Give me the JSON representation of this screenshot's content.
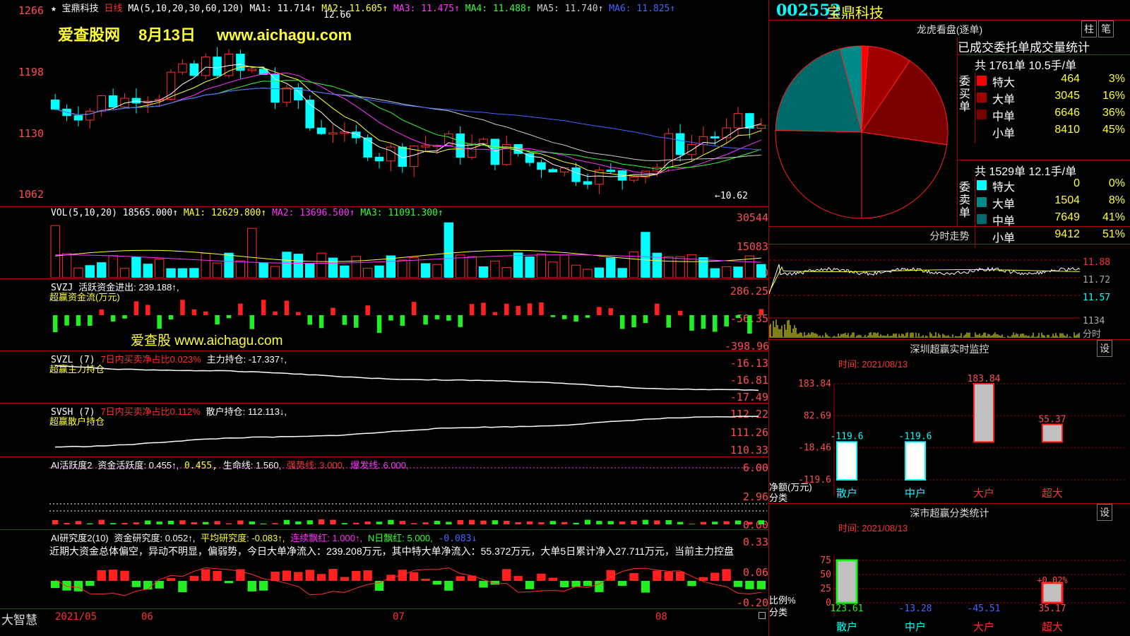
{
  "stock": {
    "code": "002552",
    "name": "宝鼎科技",
    "period": "日线",
    "star": "★"
  },
  "watermark": {
    "line1": "爱查股网",
    "date": "8月13日",
    "url": "www.aichagu.com",
    "line2": "爱查股 www.aichagu.com"
  },
  "main_panel": {
    "ma_label": "MA(5,10,20,30,60,120)",
    "ma_values": [
      {
        "name": "MA1:",
        "value": "11.714↑",
        "color": "#ffffff"
      },
      {
        "name": "MA2:",
        "value": "11.605↑",
        "color": "#ffff33"
      },
      {
        "name": "MA3:",
        "value": "11.475↑",
        "color": "#ff33ff"
      },
      {
        "name": "MA4:",
        "value": "11.488↑",
        "color": "#33ff33"
      },
      {
        "name": "MA5:",
        "value": "11.740↑",
        "color": "#cccccc"
      },
      {
        "name": "MA6:",
        "value": "11.825↑",
        "color": "#4466ff"
      }
    ],
    "y_ticks": [
      "1266",
      "1198",
      "1130",
      "1062"
    ],
    "high_label": "12.66",
    "low_label": "←10.62"
  },
  "vol_panel": {
    "label": "VOL(5,10,20)",
    "value": "18565.000↑",
    "ma1": "MA1: 12629.800↑",
    "ma2": "MA2: 13696.500↑",
    "ma3": "MA3: 11091.300↑",
    "y_ticks": [
      "30544",
      "15083",
      "0"
    ]
  },
  "svzj_panel": {
    "label": "SVZJ",
    "desc": "活跃资金进出: 239.188↑,",
    "sub": "超赢资金流(万元)",
    "y_ticks": [
      "286.25",
      "-56.35",
      "-398.96"
    ]
  },
  "svzl_panel": {
    "label": "SVZL (7)",
    "red": "7日内买卖净占比0.023%",
    "desc": "主力持仓: -17.337↑,",
    "sub": "超赢主力持仓",
    "y_ticks": [
      "-16.13",
      "-16.81",
      "-17.49"
    ]
  },
  "svsh_panel": {
    "label": "SVSH (7)",
    "red": "7日内买卖净占比0.112%",
    "desc": "散户持仓: 112.113↓,",
    "sub": "超赢散户持仓",
    "y_ticks": [
      "112.22",
      "111.26",
      "110.33"
    ]
  },
  "ai1_panel": {
    "label": "AI活跃度2",
    "desc": "资金活跃度: 0.455↑,",
    "v2": "0.455,",
    "life": "生命线: 1.560,",
    "strong": "强势线: 3.000,",
    "burst": "爆发线: 6.000,",
    "y_ticks": [
      "6.00",
      "2.96",
      "0.00"
    ]
  },
  "ai2_panel": {
    "label": "AI研究度2(10)",
    "desc": "资金研究度: 0.052↑,",
    "avg": "平均研究度: -0.083↑,",
    "cont": "连续飘红: 1.000↑,",
    "nday": "N日飘红: 5.000,",
    "neg": "-0.083↓",
    "text": "近期大资金总体偏空，异动不明显，偏弱势，今日大单净流入：239.208万元，其中特大单净流入：55.372万元，大单5日累计净入27.711万元，当前主力控盘",
    "y_ticks": [
      "0.33",
      "0.06",
      "-0.20"
    ]
  },
  "x_axis": {
    "brand": "大智慧",
    "labels": [
      "2021/05",
      "06",
      "07",
      "08"
    ]
  },
  "right": {
    "header_code": "002552",
    "header_name": "宝鼎科技",
    "lhb": {
      "title": "龙虎看盘(逐单)",
      "btn1": "柱",
      "btn2": "笔",
      "stats_title": "已成交委托单成交量统计",
      "buy_total": "共 1761单 10.5手/单",
      "sell_total": "共 1529单 12.1手/单",
      "buy_side": "委买单",
      "sell_side": "委卖单",
      "buy": [
        {
          "name": "特大",
          "vol": "464",
          "pct": "3%",
          "color": "#ff0000"
        },
        {
          "name": "大单",
          "vol": "3045",
          "pct": "16%",
          "color": "#a00000"
        },
        {
          "name": "中单",
          "vol": "6646",
          "pct": "36%",
          "color": "#7a0000"
        },
        {
          "name": "小单",
          "vol": "8410",
          "pct": "45%",
          "color": "#000000"
        }
      ],
      "sell": [
        {
          "name": "特大",
          "vol": "0",
          "pct": "0%",
          "color": "#00ffff"
        },
        {
          "name": "大单",
          "vol": "1504",
          "pct": "8%",
          "color": "#008b8b"
        },
        {
          "name": "中单",
          "vol": "7649",
          "pct": "41%",
          "color": "#006a6a"
        },
        {
          "name": "小单",
          "vol": "9412",
          "pct": "51%",
          "color": "#000000"
        }
      ]
    },
    "intraday": {
      "title": "分时走势",
      "p1": "11.88",
      "p2": "11.72",
      "p3": "11.57",
      "vol": "1134",
      "vol_label": "分时"
    },
    "sz_monitor": {
      "title": "深圳超赢实时监控",
      "btn": "设",
      "time": "时间: 2021/08/13",
      "y_ticks": [
        "183.84",
        "82.69",
        "-18.46",
        "-119.6"
      ],
      "unit": "净额(万元)",
      "cat": "分类",
      "categories": [
        "散户",
        "中户",
        "大户",
        "超大"
      ],
      "values": [
        -119.6,
        -119.6,
        183.84,
        55.37
      ],
      "labels": [
        "-119.6",
        "-119.6",
        "183.84",
        "55.37"
      ]
    },
    "sz_class": {
      "title": "深市超赢分类统计",
      "btn": "设",
      "time": "时间: 2021/08/13",
      "y_ticks": [
        "75",
        "50",
        "25",
        "0"
      ],
      "unit": "比例%",
      "cat": "分类",
      "categories": [
        "散户",
        "中户",
        "大户",
        "超大"
      ],
      "values": [
        123.61,
        -13.28,
        -45.51,
        35.17
      ],
      "labels": [
        "123.61",
        "-13.28",
        "-45.51",
        "35.17"
      ],
      "extra": "+0.02%"
    }
  },
  "chart_data": [
    {
      "type": "bar",
      "title": "深圳超赢实时监控",
      "ylabel": "净额(万元)",
      "categories": [
        "散户",
        "中户",
        "大户",
        "超大"
      ],
      "values": [
        -119.6,
        -119.6,
        183.84,
        55.37
      ],
      "ylim": [
        -119.6,
        183.84
      ]
    },
    {
      "type": "pie",
      "title": "龙虎看盘(逐单)",
      "categories": [
        "买-特大",
        "买-大单",
        "买-中单",
        "买-小单",
        "卖-特大",
        "卖-大单",
        "卖-中单",
        "卖-小单"
      ],
      "values": [
        464,
        3045,
        6646,
        8410,
        0,
        1504,
        7649,
        9412
      ]
    },
    {
      "type": "bar",
      "title": "深市超赢分类统计",
      "ylabel": "比例%",
      "categories": [
        "散户",
        "中户",
        "大户",
        "超大"
      ],
      "values": [
        123.61,
        -13.28,
        -45.51,
        35.17
      ],
      "ylim": [
        0,
        75
      ]
    }
  ]
}
